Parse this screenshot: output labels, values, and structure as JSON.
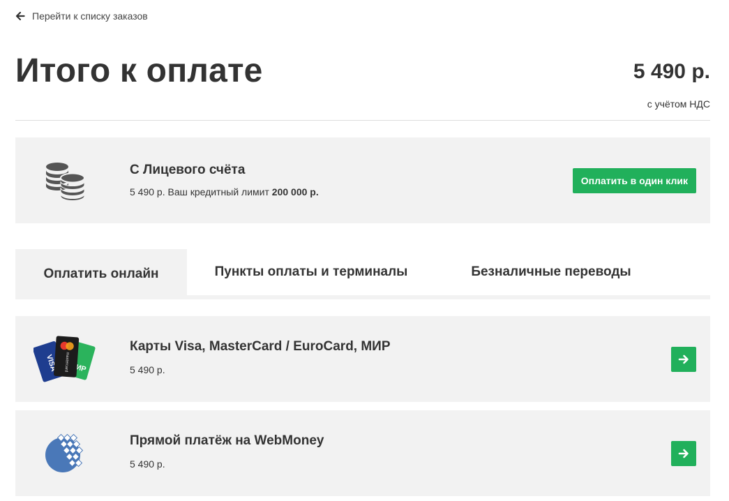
{
  "nav": {
    "back_label": "Перейти к списку заказов"
  },
  "summary": {
    "title": "Итого к оплате",
    "amount": "5 490 р.",
    "vat_note": "с учётом НДС"
  },
  "account": {
    "title": "С Лицевого счёта",
    "amount": "5 490 р.",
    "limit_text": "Ваш кредитный лимит",
    "limit_value": "200 000 р.",
    "button_label": "Оплатить в один клик"
  },
  "tabs": [
    {
      "label": "Оплатить онлайн",
      "active": true
    },
    {
      "label": "Пункты оплаты и терминалы",
      "active": false
    },
    {
      "label": "Безналичные переводы",
      "active": false
    }
  ],
  "methods": [
    {
      "title": "Карты Visa, MasterCard / EuroCard, МИР",
      "amount": "5 490 р.",
      "icon": "bank-cards-icon",
      "card_texts": [
        "VISA",
        "mastercard",
        "МИР"
      ]
    },
    {
      "title": "Прямой платёж на WebMoney",
      "amount": "5 490 р.",
      "icon": "webmoney-icon"
    }
  ],
  "colors": {
    "accent": "#21b05b",
    "panel": "#f2f2f2",
    "text": "#333333"
  }
}
